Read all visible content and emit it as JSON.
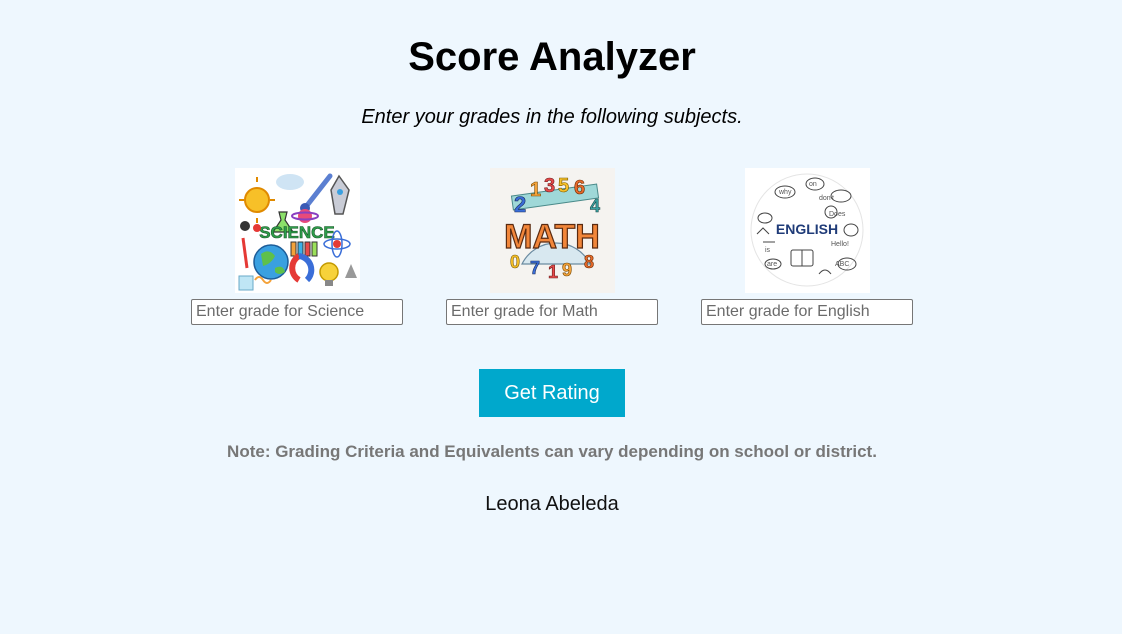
{
  "page": {
    "title": "Score Analyzer",
    "subtitle": "Enter your grades in the following subjects."
  },
  "subjects": [
    {
      "name": "Science",
      "image_text": "SCIENCE",
      "placeholder": "Enter grade for Science",
      "value": ""
    },
    {
      "name": "Math",
      "image_text": "MATH",
      "placeholder": "Enter grade for Math",
      "value": ""
    },
    {
      "name": "English",
      "image_text": "ENGLISH",
      "placeholder": "Enter grade for English",
      "value": ""
    }
  ],
  "actions": {
    "get_rating_label": "Get Rating"
  },
  "footer": {
    "note": "Note: Grading Criteria and Equivalents can vary depending on school or district.",
    "author": "Leona Abeleda"
  },
  "colors": {
    "background": "#eef7fe",
    "button": "#00a8cc",
    "note_text": "#777777"
  }
}
